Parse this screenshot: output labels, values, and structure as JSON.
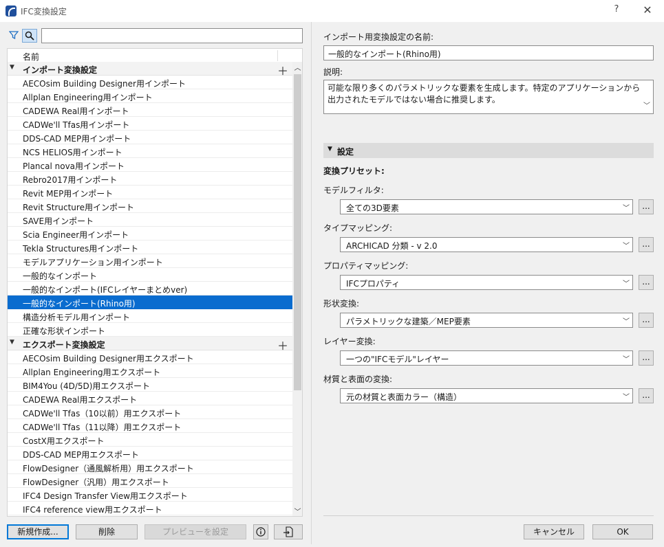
{
  "window": {
    "title": "IFC変換設定",
    "help": "?",
    "close": "✕"
  },
  "toolbar": {
    "search_placeholder": ""
  },
  "tree": {
    "column_name": "名前",
    "import_group": "インポート変換設定",
    "import_items": [
      "AECOsim Building Designer用インポート",
      "Allplan Engineering用インポート",
      "CADEWA Real用インポート",
      "CADWe'll Tfas用インポート",
      "DDS-CAD MEP用インポート",
      "NCS HELIOS用インポート",
      "Plancal nova用インポート",
      "Rebro2017用インポート",
      "Revit MEP用インポート",
      "Revit Structure用インポート",
      "SAVE用インポート",
      "Scia Engineer用インポート",
      "Tekla Structures用インポート",
      "モデルアプリケーション用インポート",
      "一般的なインポート",
      "一般的なインポート(IFCレイヤーまとめver)",
      "一般的なインポート(Rhino用)",
      "構造分析モデル用インポート",
      "正確な形状インポート"
    ],
    "selected_index": 16,
    "export_group": "エクスポート変換設定",
    "export_items": [
      "AECOsim Building Designer用エクスポート",
      "Allplan Engineering用エクスポート",
      "BIM4You (4D/5D)用エクスポート",
      "CADEWA Real用エクスポート",
      "CADWe'll Tfas（10以前）用エクスポート",
      "CADWe'll Tfas（11以降）用エクスポート",
      "CostX用エクスポート",
      "DDS-CAD MEP用エクスポート",
      "FlowDesigner（通風解析用）用エクスポート",
      "FlowDesigner（汎用）用エクスポート",
      "IFC4 Design Transfer View用エクスポート",
      "IFC4 reference view用エクスポート"
    ]
  },
  "bottom_left": {
    "new": "新規作成...",
    "delete": "削除",
    "preview": "プレビューを設定"
  },
  "right": {
    "name_label": "インポート用変換設定の名前:",
    "name_value": "一般的なインポート(Rhino用)",
    "desc_label": "説明:",
    "desc_value": "可能な限り多くのパラメトリックな要素を生成します。特定のアプリケーションから出力されたモデルではない場合に推奨します。",
    "section": "設定",
    "preset_label": "変換プリセット:",
    "fields": [
      {
        "label": "モデルフィルタ:",
        "value": "全ての3D要素"
      },
      {
        "label": "タイプマッピング:",
        "value": "ARCHICAD 分類 - v 2.0"
      },
      {
        "label": "プロパティマッピング:",
        "value": "IFCプロパティ"
      },
      {
        "label": "形状変換:",
        "value": "パラメトリックな建築／MEP要素"
      },
      {
        "label": "レイヤー変換:",
        "value": "一つの\"IFCモデル\"レイヤー"
      },
      {
        "label": "材質と表面の変換:",
        "value": "元の材質と表面カラー（構造）"
      }
    ],
    "more": "...",
    "cancel": "キャンセル",
    "ok": "OK"
  }
}
